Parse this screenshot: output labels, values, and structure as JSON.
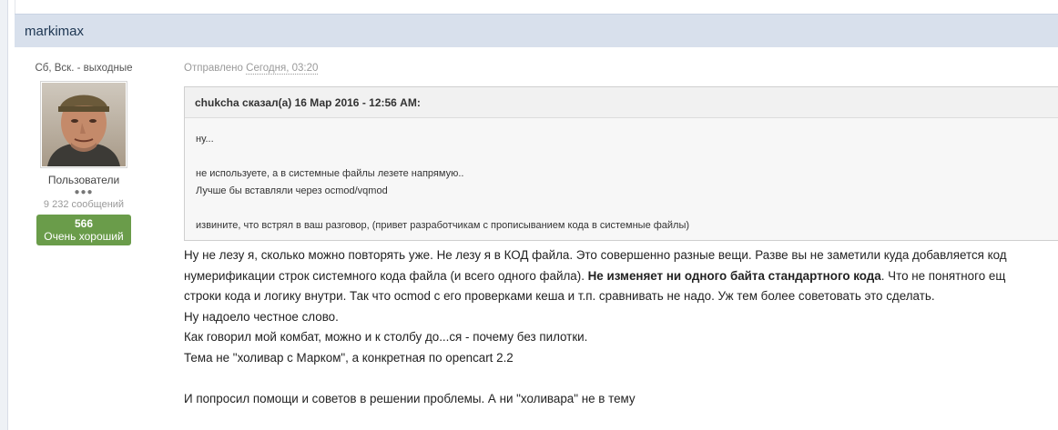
{
  "post": {
    "author": "markimax",
    "author_status": "Сб, Вск. - выходные",
    "group": "Пользователи",
    "rank_pips": "●●●",
    "post_count": "9 232 сообщений",
    "reputation": {
      "value": "566",
      "label": "Очень хороший",
      "color": "#6a9c4a"
    },
    "posted_prefix": "Отправлено",
    "posted_date": "Сегодня, 03:20",
    "quote": {
      "header": "chukcha сказал(а) 16 Мар 2016 - 12:56 AM:",
      "lines": [
        "ну...",
        "",
        "не используете, а в системные файлы лезете напрямую..",
        "Лучше бы вставляли через ocmod/vqmod",
        "",
        "извините, что встрял в ваш разговор, (привет разработчикам с прописыванием кода в системные файлы)"
      ]
    },
    "message": {
      "line1": "Ну не лезу я, сколько можно повторять уже. Не лезу я в КОД файла. Это совершенно разные вещи.  Разве вы не заметили куда добавляется код",
      "line2_before": "нумерификации строк системного кода файла (и всего одного файла). ",
      "line2_bold": "Не изменяет ни одного байта стандартного кода",
      "line2_after": ". Что не понятного ещ",
      "line3": "строки кода и логику внутри. Так что ocmod с его проверками кеша и т.п. сравнивать не надо. Уж тем более советовать это сделать.",
      "line4": "Ну надоело честное слово.",
      "line5": "Как говорил мой комбат, можно и к столбу до...ся - почему без пилотки.",
      "line6": "Тема не \"холивар с Марком\", а конкретная по opencart 2.2",
      "line7": "И попросил помощи и советов в решении проблемы. А ни \"холивара\" не в тему"
    }
  }
}
